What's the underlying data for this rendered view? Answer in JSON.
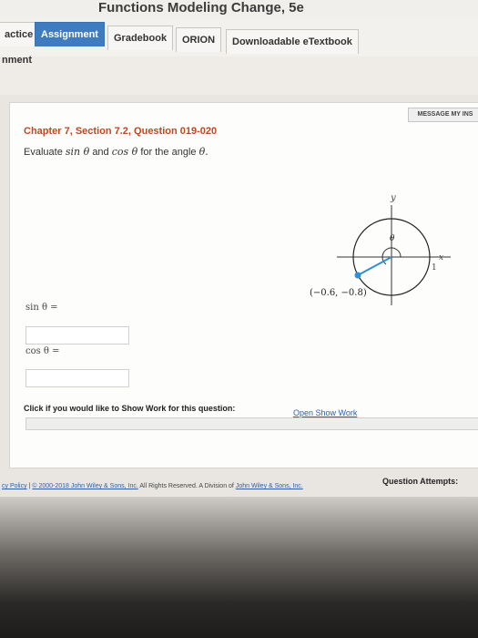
{
  "header": {
    "book_title": "Functions Modeling Change, 5e"
  },
  "tabs": [
    {
      "label": "actice"
    },
    {
      "label": "Assignment"
    },
    {
      "label": "Gradebook"
    },
    {
      "label": "ORION"
    },
    {
      "label": "Downloadable eTextbook"
    }
  ],
  "subheader": {
    "label": "nment"
  },
  "message_button": "MESSAGE MY INS",
  "question": {
    "title": "Chapter 7, Section 7.2, Question 019-020",
    "prompt_pre": "Evaluate",
    "prompt_sin": "sin θ",
    "prompt_and": "and",
    "prompt_cos": "cos θ",
    "prompt_post": "for the angle",
    "prompt_theta": "θ."
  },
  "figure": {
    "y_label": "y",
    "x_label": "x",
    "one_label": "1",
    "theta_label": "θ",
    "point_label": "(−0.6, −0.8)",
    "point_color": "#2f8fd8"
  },
  "answers": {
    "sin_label": "sin θ =",
    "cos_label": "cos θ =",
    "sin_value": "",
    "cos_value": ""
  },
  "show_work": {
    "prompt": "Click if you would like to Show Work for this question:",
    "link": "Open Show Work"
  },
  "attempts": "Question Attempts:",
  "footer": {
    "privacy": "cy Policy",
    "sep": "|",
    "copyright": "© 2000-2018 John Wiley & Sons, Inc.",
    "rights": "All Rights Reserved. A Division of",
    "company": "John Wiley & Sons, Inc."
  }
}
